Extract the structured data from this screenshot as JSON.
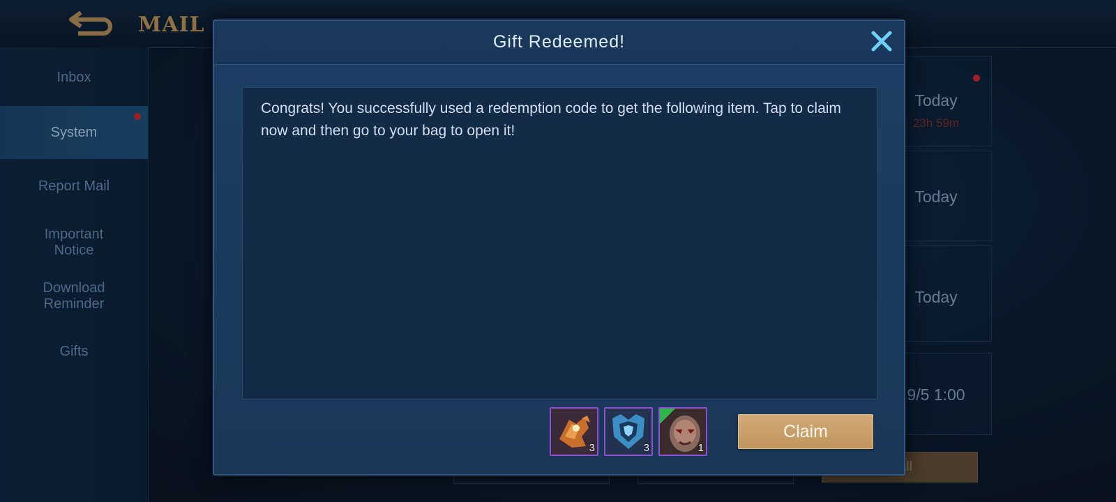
{
  "header": {
    "title": "MAIL"
  },
  "sidebar": {
    "items": [
      {
        "label": "Inbox"
      },
      {
        "label": "System"
      },
      {
        "label": "Report Mail"
      },
      {
        "label": "Important Notice"
      },
      {
        "label": "Download Reminder"
      },
      {
        "label": "Gifts"
      }
    ]
  },
  "mail_list": {
    "items": [
      {
        "time": "Today",
        "timer": "23h 59m"
      },
      {
        "time": "Today"
      },
      {
        "time": "Today"
      },
      {
        "time": "9/5 1:00"
      }
    ],
    "claim_all_label": "n All"
  },
  "dialog": {
    "title": "Gift Redeemed!",
    "message": "Congrats! You successfully used a redemption code to get the following item. Tap to claim now and then go to your bag to open it!",
    "rewards": [
      {
        "icon": "orange-fragment-icon",
        "qty": "3"
      },
      {
        "icon": "blue-fragment-icon",
        "qty": "3"
      },
      {
        "icon": "hero-portrait-icon",
        "qty": "1"
      }
    ],
    "claim_label": "Claim"
  },
  "colors": {
    "accent_gold": "#c9a06a",
    "dialog_blue": "#1d3f63",
    "close_blue": "#6fd0ff",
    "reward_border": "#8e4fd2",
    "notification_red": "#c0262b"
  }
}
